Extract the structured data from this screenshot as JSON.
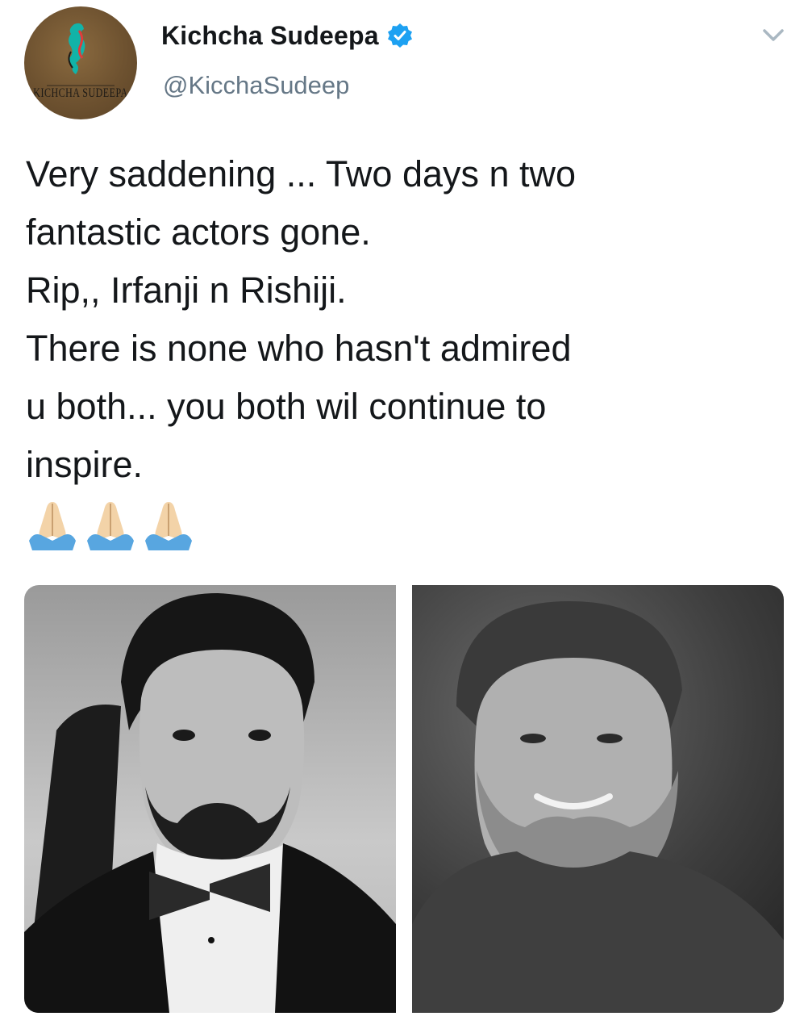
{
  "author": {
    "display_name": "Kichcha Sudeepa",
    "handle": "@KicchaSudeep",
    "verified": true,
    "avatar_logo_text": "KICHCHA SUDEEPA"
  },
  "icons": {
    "verified": "verified-badge-icon",
    "menu": "chevron-down-icon",
    "emoji": "folded-hands-emoji"
  },
  "tweet": {
    "text": "Very saddening ... Two days n two\nfantastic actors gone.\nRip,, Irfanji n Rishiji.\nThere is none who hasn't admired\nu both... you both wil continue to\ninspire.",
    "emoji_count": 3
  },
  "colors": {
    "verified_blue": "#1da1f2",
    "handle_gray": "#657786",
    "text": "#14171a",
    "chevron": "#aab8c2"
  }
}
